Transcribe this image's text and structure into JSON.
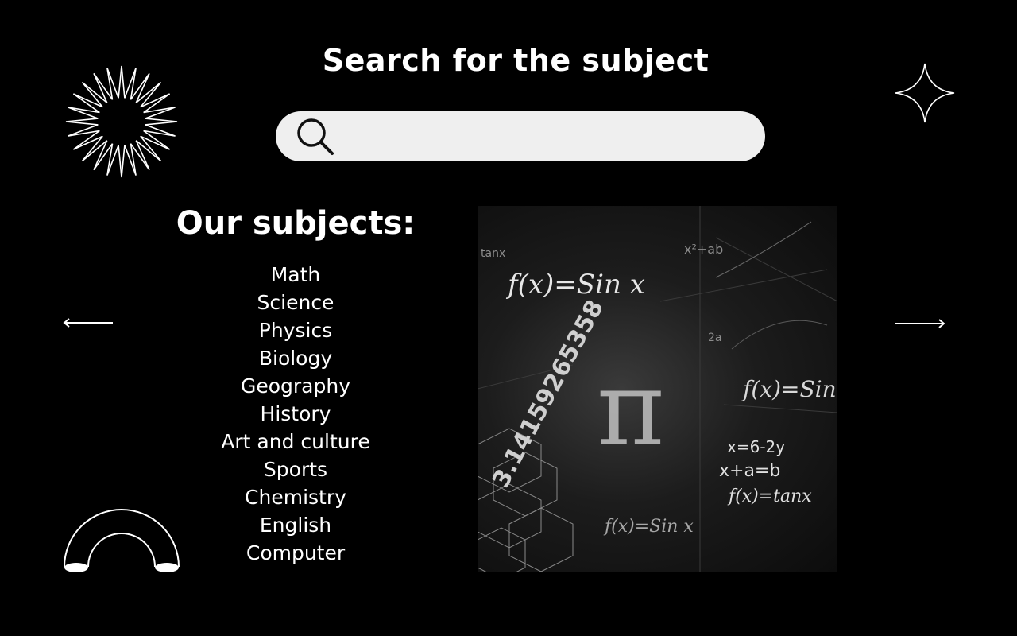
{
  "header": {
    "title": "Search for the subject"
  },
  "search": {
    "value": "",
    "placeholder": ""
  },
  "subjects": {
    "title": "Our subjects:",
    "items": [
      "Math",
      "Science",
      "Physics",
      "Biology",
      "Geography",
      "History",
      "Art and culture",
      "Sports",
      "Chemistry",
      "English",
      "Computer"
    ]
  },
  "photo": {
    "formulas": [
      "f(x)=Sin x",
      "f(x)=Sin x",
      "x=6-2y",
      "x+a=b",
      "f(x)=tanx",
      "f(x)=Sin x",
      "3.14159265358",
      "x²+ab",
      "2a",
      "tanx"
    ],
    "symbol": "π"
  },
  "navigation": {
    "prev": "←",
    "next": "→"
  },
  "icons": {
    "search": "search-icon",
    "prev": "arrow-left-icon",
    "next": "arrow-right-icon",
    "starburst": "starburst-icon",
    "sparkle": "sparkle-star-icon",
    "arch": "arch-icon"
  },
  "colors": {
    "background": "#000000",
    "text": "#ffffff",
    "search_bar": "#efefef"
  }
}
